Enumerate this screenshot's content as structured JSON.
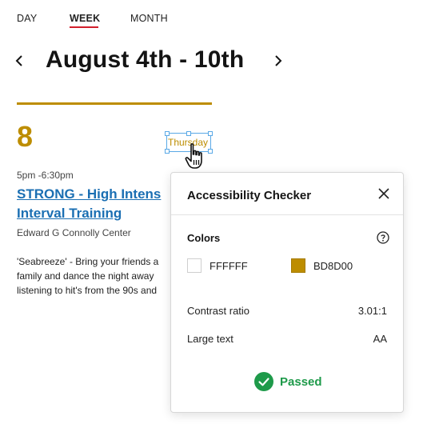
{
  "tabs": {
    "day": "DAY",
    "week": "WEEK",
    "month": "MONTH",
    "active": "WEEK"
  },
  "header": {
    "title": "August 4th - 10th"
  },
  "day": {
    "number": "8",
    "weekday": "Thursday"
  },
  "event": {
    "time": "5pm -6:30pm",
    "title_line1": "STRONG - High Intens",
    "title_line2": "Interval Training",
    "location": "Edward G Connolly Center",
    "description": [
      "'Seabreeze' - Bring your friends a",
      "family and dance the night away",
      "listening to hit's from the 90s and"
    ]
  },
  "checker": {
    "title": "Accessibility Checker",
    "colors_label": "Colors",
    "color1": "FFFFFF",
    "color2": "BD8D00",
    "contrast_label": "Contrast ratio",
    "contrast_value": "3.01:1",
    "large_text_label": "Large text",
    "large_text_value": "AA",
    "status": "Passed"
  },
  "colors": {
    "accent_gold": "#BD8D00",
    "link_blue": "#1B6FB3",
    "active_tab_underline": "#D21F2B",
    "pass_green": "#1E9A4A"
  }
}
